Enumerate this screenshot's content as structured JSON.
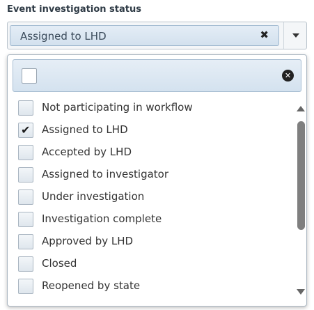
{
  "label": "Event investigation status",
  "selected_chip": "Assigned to LHD",
  "chip_remove_icon": "x-icon",
  "dropdown_toggle_icon": "caret-down-icon",
  "search": {
    "value": "",
    "clear_icon": "clear-circle-icon"
  },
  "options": [
    {
      "label": "Not participating in workflow",
      "checked": false
    },
    {
      "label": "Assigned to LHD",
      "checked": true
    },
    {
      "label": "Accepted by LHD",
      "checked": false
    },
    {
      "label": "Assigned to investigator",
      "checked": false
    },
    {
      "label": "Under investigation",
      "checked": false
    },
    {
      "label": "Investigation complete",
      "checked": false
    },
    {
      "label": "Approved by LHD",
      "checked": false
    },
    {
      "label": "Closed",
      "checked": false
    },
    {
      "label": "Reopened by state",
      "checked": false
    }
  ]
}
